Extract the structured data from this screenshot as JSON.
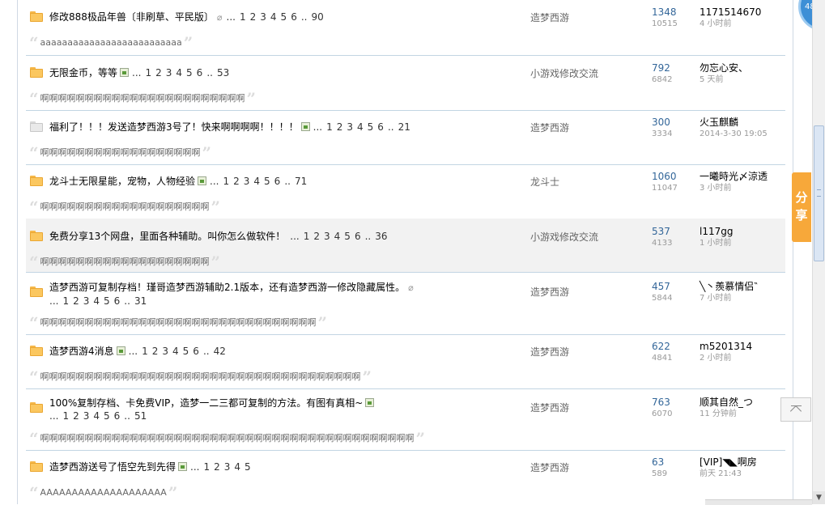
{
  "threads": [
    {
      "icon": "orange",
      "title": "修改888极品年兽〔非刷草、平民版〕",
      "attachment": "clip",
      "pages": [
        "...",
        "1",
        "2",
        "3",
        "4",
        "5",
        "6",
        "..",
        "90"
      ],
      "forum": "造梦西游",
      "replies": "1348",
      "views": "10515",
      "last_user": "1171514670",
      "last_time": "4 小时前",
      "preview": "aaaaaaaaaaaaaaaaaaaaaaaaaa"
    },
    {
      "icon": "orange",
      "title": "无限金币，等等",
      "attachment": "image",
      "pages": [
        "...",
        "1",
        "2",
        "3",
        "4",
        "5",
        "6",
        "..",
        "53"
      ],
      "forum": "小游戏修改交流",
      "replies": "792",
      "views": "6842",
      "last_user": "勿忘心安、",
      "last_time": "5 天前",
      "preview": "啊啊啊啊啊啊啊啊啊啊啊啊啊啊啊啊啊啊啊啊啊啊啊"
    },
    {
      "icon": "gray",
      "title": "福利了！！！发送造梦西游3号了！快来啊啊啊啊！！！！",
      "attachment": "image",
      "pages": [
        "...",
        "1",
        "2",
        "3",
        "4",
        "5",
        "6",
        "..",
        "21"
      ],
      "forum": "造梦西游",
      "replies": "300",
      "views": "3334",
      "last_user": "火玉麒麟",
      "last_time": "2014-3-30 19:05",
      "preview": "啊啊啊啊啊啊啊啊啊啊啊啊啊啊啊啊啊啊"
    },
    {
      "icon": "orange",
      "title": "龙斗士无限星能，宠物，人物经验",
      "attachment": "image",
      "pages": [
        "...",
        "1",
        "2",
        "3",
        "4",
        "5",
        "6",
        "..",
        "71"
      ],
      "forum": "龙斗士",
      "replies": "1060",
      "views": "11047",
      "last_user": "一曦時光〆涼透",
      "last_time": "3 小时前",
      "preview": "啊啊啊啊啊啊啊啊啊啊啊啊啊啊啊啊啊啊啊"
    },
    {
      "icon": "orange",
      "highlight": true,
      "title": "免费分享13个网盘，里面各种辅助。叫你怎么做软件！",
      "attachment": "",
      "pages": [
        "...",
        "1",
        "2",
        "3",
        "4",
        "5",
        "6",
        "..",
        "36"
      ],
      "forum": "小游戏修改交流",
      "replies": "537",
      "views": "4133",
      "last_user": "l117gg",
      "last_time": "1 小时前",
      "preview": "啊啊啊啊啊啊啊啊啊啊啊啊啊啊啊啊啊啊啊"
    },
    {
      "icon": "orange",
      "title": "造梦西游可复制存档！瑾哥造梦西游辅助2.1版本，还有造梦西游一修改隐藏属性。",
      "attachment": "clip",
      "pages": [
        "...",
        "1",
        "2",
        "3",
        "4",
        "5",
        "6",
        "..",
        "31"
      ],
      "forum": "造梦西游",
      "replies": "457",
      "views": "5844",
      "last_user": "╲丶羨慕情侣‶",
      "last_time": "7 小时前",
      "preview": "啊啊啊啊啊啊啊啊啊啊啊啊啊啊啊啊啊啊啊啊啊啊啊啊啊啊啊啊啊啊啊"
    },
    {
      "icon": "orange",
      "title": "造梦西游4消息",
      "attachment": "image",
      "pages": [
        "...",
        "1",
        "2",
        "3",
        "4",
        "5",
        "6",
        "..",
        "42"
      ],
      "forum": "造梦西游",
      "replies": "622",
      "views": "4841",
      "last_user": "m5201314",
      "last_time": "2 小时前",
      "preview": "啊啊啊啊啊啊啊啊啊啊啊啊啊啊啊啊啊啊啊啊啊啊啊啊啊啊啊啊啊啊啊啊啊啊啊啊"
    },
    {
      "icon": "orange",
      "title": "100%复制存档、卡免费VIP，造梦一二三都可复制的方法。有图有真相~",
      "attachment": "image",
      "pages": [
        "...",
        "1",
        "2",
        "3",
        "4",
        "5",
        "6",
        "..",
        "51"
      ],
      "forum": "造梦西游",
      "replies": "763",
      "views": "6070",
      "last_user": "顺其自然_つ",
      "last_time": "11 分钟前",
      "preview": "啊啊啊啊啊啊啊啊啊啊啊啊啊啊啊啊啊啊啊啊啊啊啊啊啊啊啊啊啊啊啊啊啊啊啊啊啊啊啊啊啊啊"
    },
    {
      "icon": "orange",
      "title": "造梦西游送号了悟空先到先得",
      "attachment": "image",
      "pages": [
        "...",
        "1",
        "2",
        "3",
        "4",
        "5"
      ],
      "forum": "造梦西游",
      "replies": "63",
      "views": "589",
      "last_user": "[VIP]◥◣啊房",
      "last_time": "前天 21:43",
      "preview": "AAAAAAAAAAAAAAAAAAAA"
    }
  ],
  "widgets": {
    "progress": "48%",
    "share_label": "分享",
    "scroll_down": "▼"
  },
  "colors": {
    "link_blue": "#336699",
    "share_orange": "#f7a83a",
    "row_border": "#c2d5e3",
    "highlight_row": "#f2f2f2"
  }
}
